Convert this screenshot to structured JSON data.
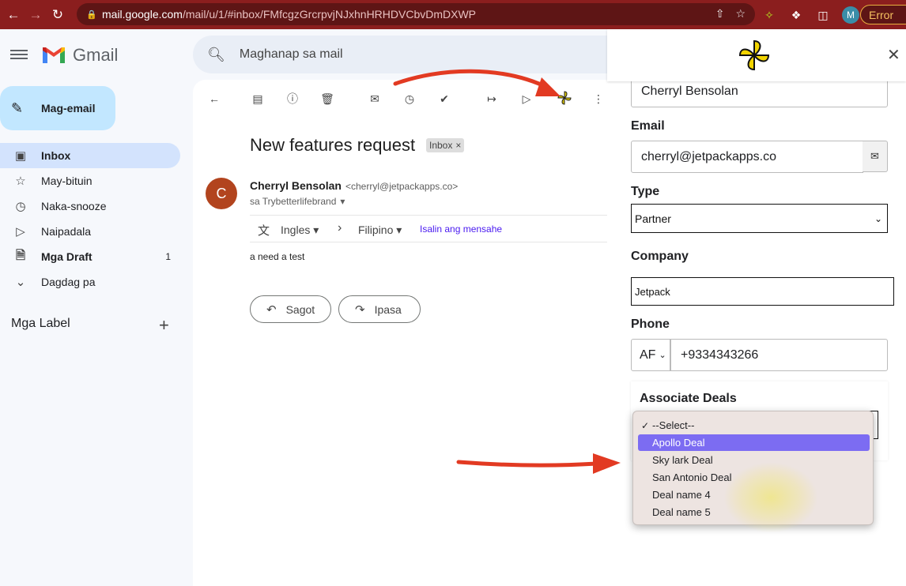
{
  "browser": {
    "url_host": "mail.google.com",
    "url_path": "/mail/u/1/#inbox/FMfcgzGrcrpvjNJxhnHRHDVCbvDmDXWP",
    "profile_initial": "M",
    "error_label": "Error"
  },
  "gmail": {
    "app_name": "Gmail",
    "compose_label": "Mag-email",
    "search_placeholder": "Maghanap sa mail",
    "nav": [
      {
        "label": "Inbox",
        "icon": "inbox-icon"
      },
      {
        "label": "May-bituin",
        "icon": "star-icon"
      },
      {
        "label": "Naka-snooze",
        "icon": "clock-icon"
      },
      {
        "label": "Naipadala",
        "icon": "send-icon"
      },
      {
        "label": "Mga Draft",
        "icon": "draft-icon",
        "count": "1"
      },
      {
        "label": "Dagdag pa",
        "icon": "chevron-down-icon"
      }
    ],
    "labels_heading": "Mga Label"
  },
  "message": {
    "subject": "New features request",
    "chip": "Inbox",
    "sender_initial": "C",
    "sender_name": "Cherryl Bensolan",
    "sender_email": "<cherryl@jetpackapps.co>",
    "to_line": "sa Trybetterlifebrand",
    "translate_from": "Ingles",
    "translate_to": "Filipino",
    "translate_link": "Isalin ang mensahe",
    "body": "a need a test",
    "reply_label": "Sagot",
    "forward_label": "Ipasa"
  },
  "panel": {
    "name_value": "Cherryl Bensolan",
    "email_label": "Email",
    "email_value": "cherryl@jetpackapps.co",
    "type_label": "Type",
    "type_value": "Partner",
    "company_label": "Company",
    "company_value": "Jetpack",
    "phone_label": "Phone",
    "phone_country": "AF",
    "phone_value": "+9334343266",
    "deals_label": "Associate Deals",
    "deal_options": [
      "--Select--",
      "Apollo Deal",
      "Sky lark Deal",
      "San Antonio Deal",
      "Deal name 4",
      "Deal name 5"
    ],
    "checked_option": "--Select--",
    "highlighted_option": "Apollo Deal"
  },
  "colors": {
    "chrome": "#8b1e1e",
    "nav_active": "#d3e3fd",
    "compose": "#c2e7ff",
    "highlight": "#7c6cf2",
    "annotation_arrow": "#e23a22"
  }
}
